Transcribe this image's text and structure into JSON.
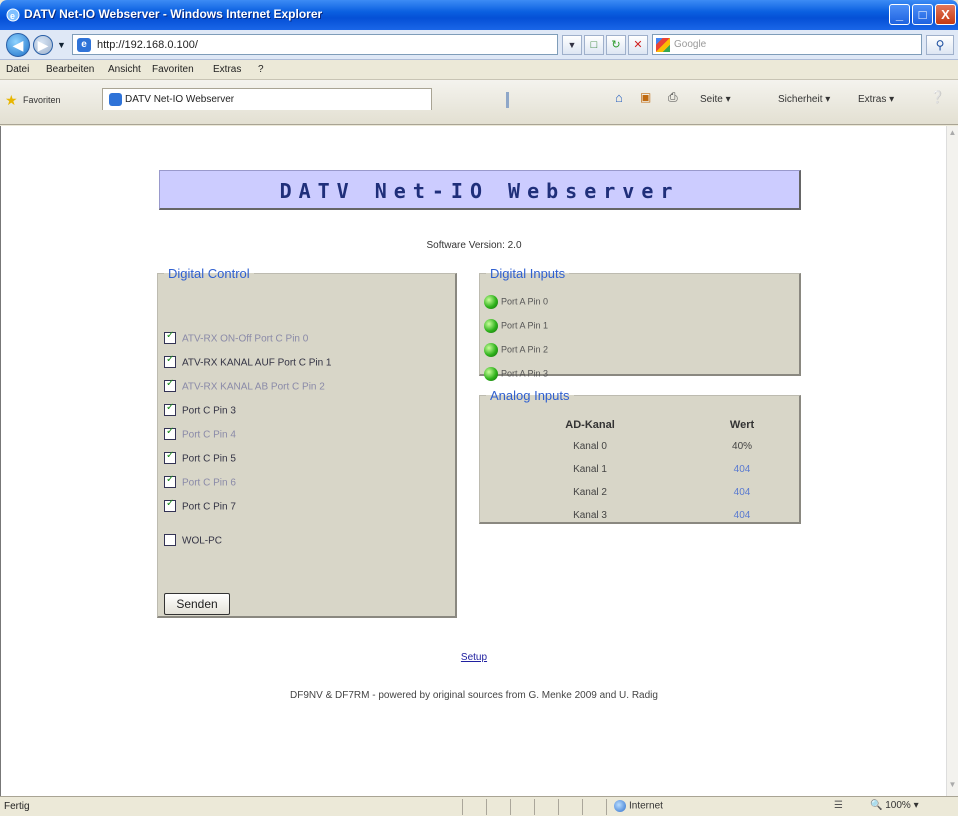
{
  "window": {
    "title": "DATV Net-IO Webserver - Windows Internet Explorer",
    "min_label": "_",
    "max_label": "□",
    "close_label": "X"
  },
  "addressbar": {
    "url": "http://192.168.0.100/",
    "search_placeholder": "Google"
  },
  "menu": {
    "items": [
      "Datei",
      "Bearbeiten",
      "Ansicht",
      "Favoriten",
      "Extras",
      "?"
    ]
  },
  "tabs": {
    "favorites_label": "Favoriten",
    "active_tab": "DATV Net-IO Webserver"
  },
  "commandbar": {
    "page": "Seite",
    "safety": "Sicherheit",
    "extras": "Extras"
  },
  "page": {
    "header_title": "DATV Net-IO Webserver",
    "software_version": "Software Version: 2.0",
    "digital_control": {
      "legend": "Digital Control",
      "items": [
        {
          "label": "ATV-RX ON-Off Port C Pin 0",
          "checked": true,
          "faded": true
        },
        {
          "label": "ATV-RX KANAL AUF Port C Pin 1",
          "checked": true,
          "faded": false
        },
        {
          "label": "ATV-RX KANAL AB Port C Pin 2",
          "checked": true,
          "faded": true
        },
        {
          "label": "Port C Pin 3",
          "checked": true,
          "faded": false
        },
        {
          "label": "Port C Pin 4",
          "checked": true,
          "faded": true
        },
        {
          "label": "Port C Pin 5",
          "checked": true,
          "faded": false
        },
        {
          "label": "Port C Pin 6",
          "checked": true,
          "faded": true
        },
        {
          "label": "Port C Pin 7",
          "checked": true,
          "faded": false
        },
        {
          "label": "WOL-PC",
          "checked": false,
          "faded": false
        }
      ],
      "send_button": "Senden"
    },
    "digital_inputs": {
      "legend": "Digital Inputs",
      "items": [
        "Port A Pin 0",
        "Port A Pin 1",
        "Port A Pin 2",
        "Port A Pin 3"
      ]
    },
    "analog_inputs": {
      "legend": "Analog Inputs",
      "col_channel": "AD-Kanal",
      "col_value": "Wert",
      "rows": [
        {
          "channel": "Kanal 0",
          "value": "40%"
        },
        {
          "channel": "Kanal 1",
          "value": "404"
        },
        {
          "channel": "Kanal 2",
          "value": "404"
        },
        {
          "channel": "Kanal 3",
          "value": "404"
        }
      ]
    },
    "setup_link": "Setup",
    "footer": "DF9NV & DF7RM - powered by original sources from G. Menke 2009 and U. Radig"
  },
  "statusbar": {
    "status": "Fertig",
    "zone": "Internet",
    "zoom": "100%"
  },
  "colors": {
    "header_bg": "#ccccff",
    "legend_blue": "#3060d0",
    "fieldset_bg": "#d8d6c8",
    "led_green": "#2fb21c"
  }
}
